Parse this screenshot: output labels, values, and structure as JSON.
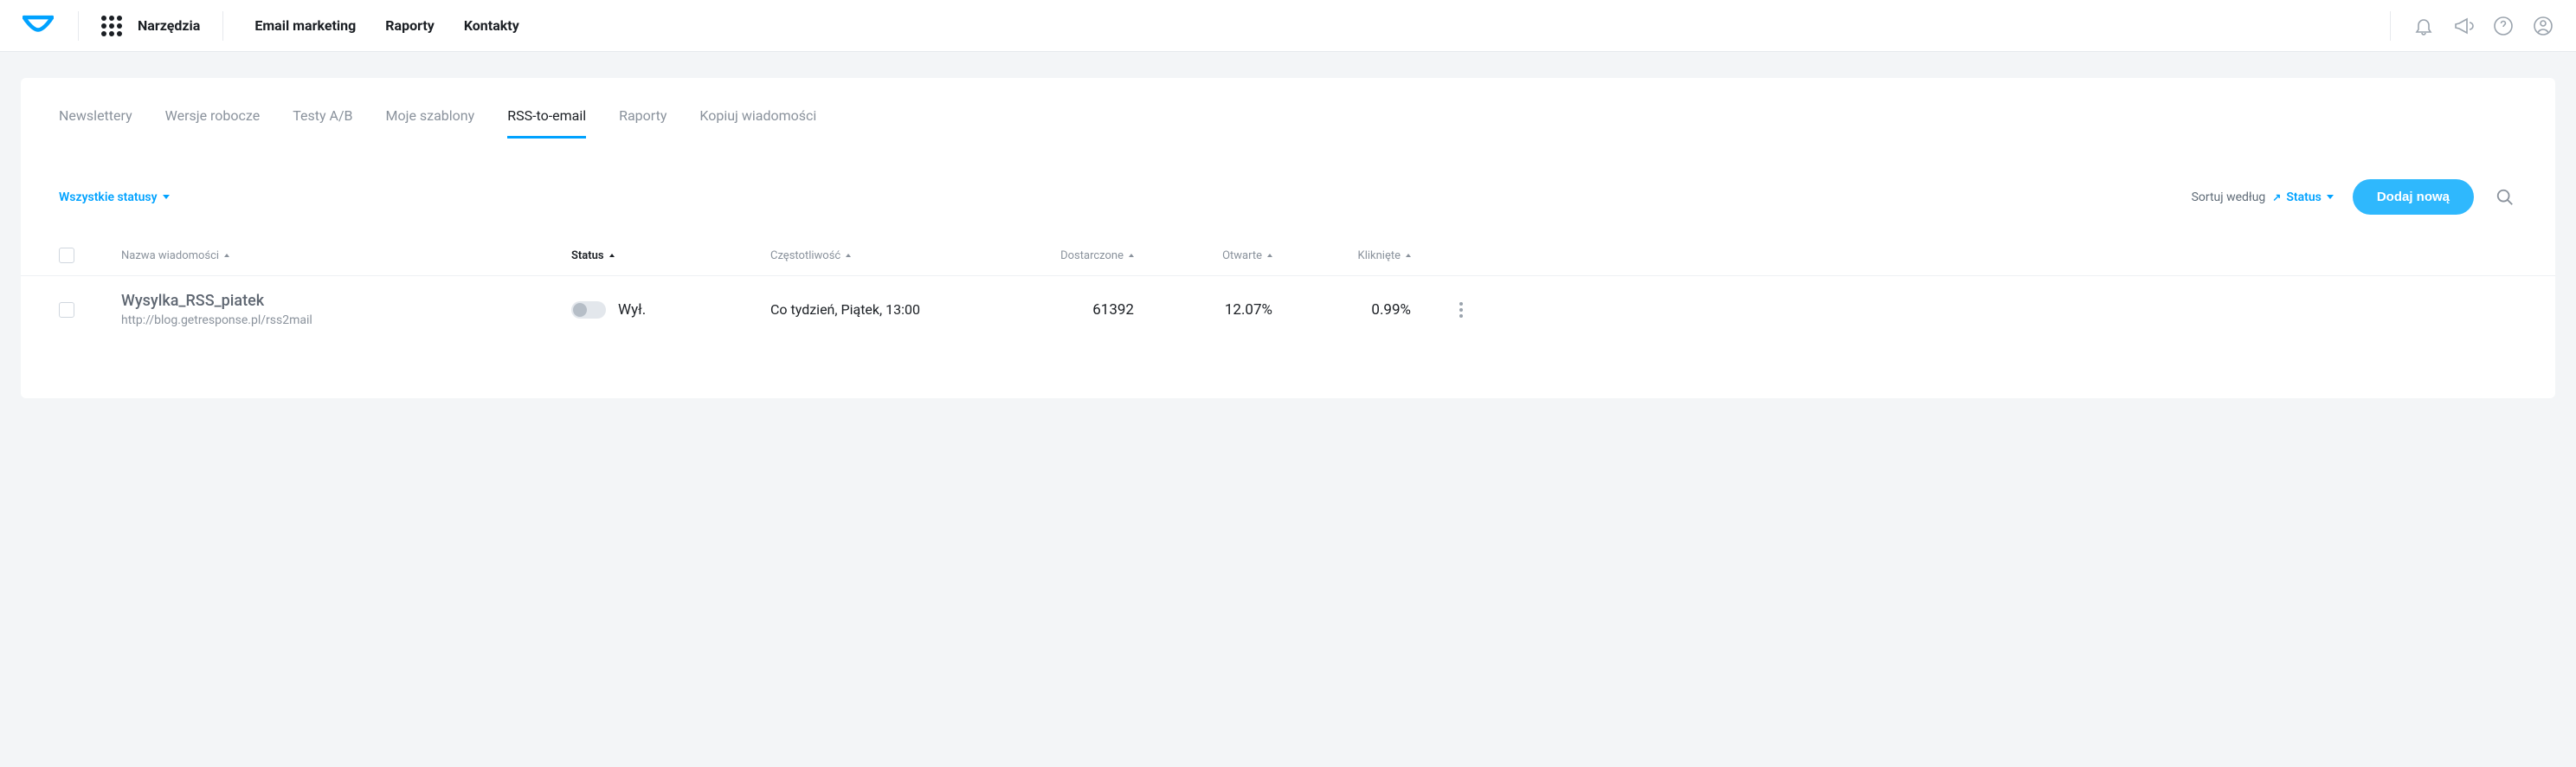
{
  "topnav": {
    "tools_label": "Narzędzia",
    "links": [
      "Email marketing",
      "Raporty",
      "Kontakty"
    ]
  },
  "tabs": [
    {
      "label": "Newslettery",
      "active": false
    },
    {
      "label": "Wersje robocze",
      "active": false
    },
    {
      "label": "Testy A/B",
      "active": false
    },
    {
      "label": "Moje szablony",
      "active": false
    },
    {
      "label": "RSS-to-email",
      "active": true
    },
    {
      "label": "Raporty",
      "active": false
    },
    {
      "label": "Kopiuj wiadomości",
      "active": false
    }
  ],
  "filters": {
    "status_filter_label": "Wszystkie statusy",
    "sort_prefix": "Sortuj według",
    "sort_value": "Status",
    "add_button": "Dodaj nową"
  },
  "columns": {
    "name": "Nazwa wiadomości",
    "status": "Status",
    "frequency": "Częstotliwość",
    "delivered": "Dostarczone",
    "opened": "Otwarte",
    "clicked": "Kliknięte"
  },
  "rows": [
    {
      "name": "Wysylka_RSS_piatek",
      "url": "http://blog.getresponse.pl/rss2mail",
      "status_on": false,
      "status_label": "Wył.",
      "frequency": "Co tydzień, Piątek, 13:00",
      "delivered": "61392",
      "opened": "12.07%",
      "clicked": "0.99%"
    }
  ]
}
